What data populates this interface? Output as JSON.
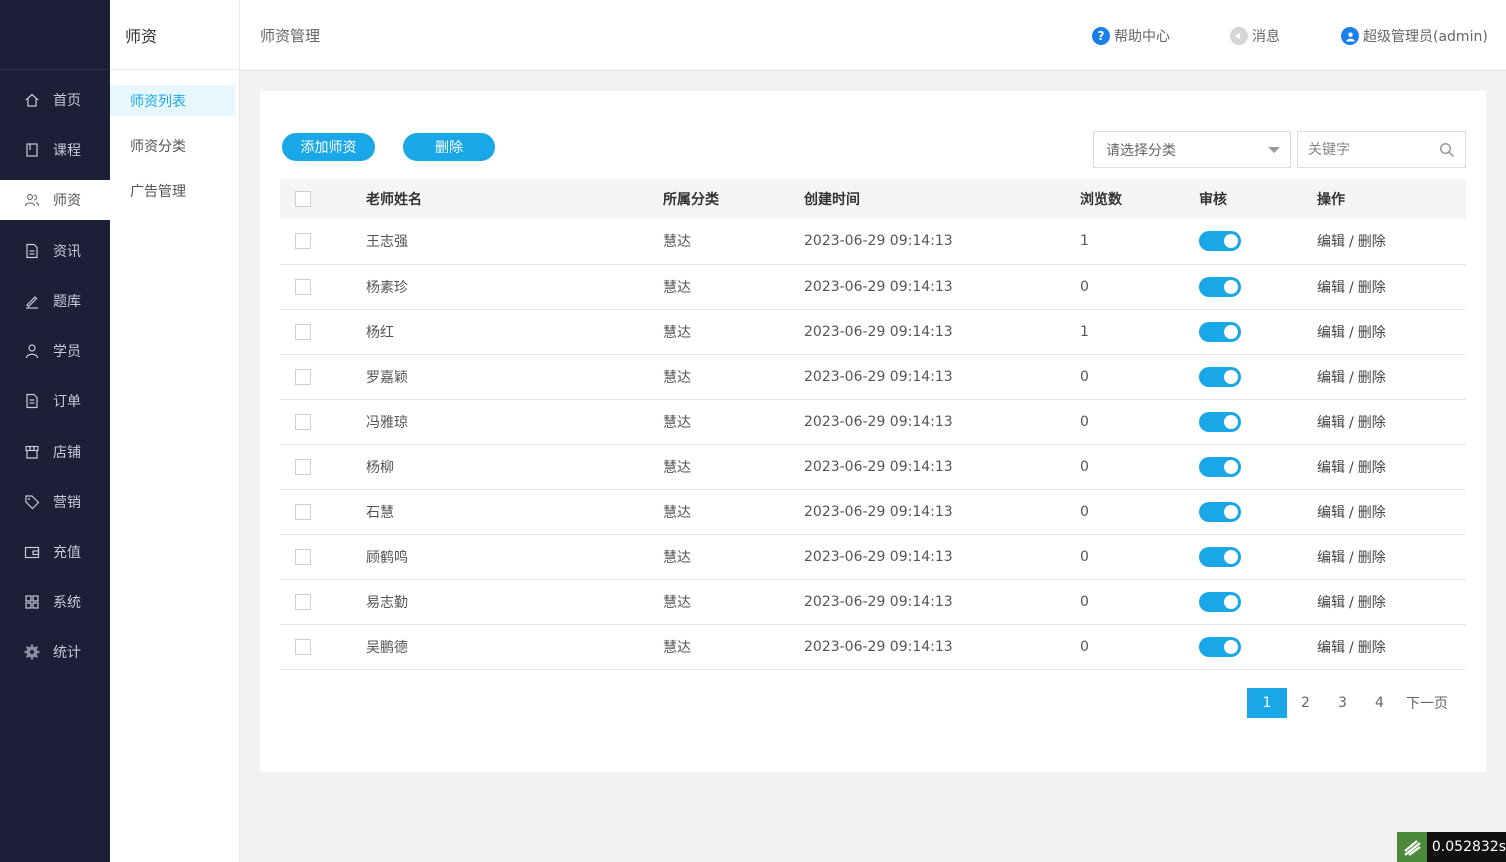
{
  "sidebar": {
    "items": [
      {
        "label": "首页",
        "icon": "home-icon"
      },
      {
        "label": "课程",
        "icon": "book-icon"
      },
      {
        "label": "师资",
        "icon": "users-icon"
      },
      {
        "label": "资讯",
        "icon": "news-icon"
      },
      {
        "label": "题库",
        "icon": "pen-icon"
      },
      {
        "label": "学员",
        "icon": "user-icon"
      },
      {
        "label": "订单",
        "icon": "order-icon"
      },
      {
        "label": "店铺",
        "icon": "shop-icon"
      },
      {
        "label": "营销",
        "icon": "tag-icon"
      },
      {
        "label": "充值",
        "icon": "wallet-icon"
      },
      {
        "label": "系统",
        "icon": "grid-icon"
      },
      {
        "label": "统计",
        "icon": "gear-icon"
      }
    ],
    "active": "师资"
  },
  "subnav": {
    "title": "师资",
    "items": [
      {
        "label": "师资列表"
      },
      {
        "label": "师资分类"
      },
      {
        "label": "广告管理"
      }
    ]
  },
  "header": {
    "title": "师资管理",
    "help": "帮助中心",
    "messages": "消息",
    "user": "超级管理员(admin)"
  },
  "toolbar": {
    "add_label": "添加师资",
    "delete_label": "删除",
    "category_placeholder": "请选择分类",
    "keyword_placeholder": "关键字"
  },
  "table": {
    "headers": {
      "name": "老师姓名",
      "category": "所属分类",
      "created": "创建时间",
      "views": "浏览数",
      "review": "审核",
      "ops": "操作"
    },
    "rows": [
      {
        "name": "王志强",
        "category": "慧达",
        "created": "2023-06-29 09:14:13",
        "views": "1",
        "review_on": true
      },
      {
        "name": "杨素珍",
        "category": "慧达",
        "created": "2023-06-29 09:14:13",
        "views": "0",
        "review_on": true
      },
      {
        "name": "杨红",
        "category": "慧达",
        "created": "2023-06-29 09:14:13",
        "views": "1",
        "review_on": true
      },
      {
        "name": "罗嘉颖",
        "category": "慧达",
        "created": "2023-06-29 09:14:13",
        "views": "0",
        "review_on": true
      },
      {
        "name": "冯雅琼",
        "category": "慧达",
        "created": "2023-06-29 09:14:13",
        "views": "0",
        "review_on": true
      },
      {
        "name": "杨柳",
        "category": "慧达",
        "created": "2023-06-29 09:14:13",
        "views": "0",
        "review_on": true
      },
      {
        "name": "石慧",
        "category": "慧达",
        "created": "2023-06-29 09:14:13",
        "views": "0",
        "review_on": true
      },
      {
        "name": "顾鹤鸣",
        "category": "慧达",
        "created": "2023-06-29 09:14:13",
        "views": "0",
        "review_on": true
      },
      {
        "name": "易志勤",
        "category": "慧达",
        "created": "2023-06-29 09:14:13",
        "views": "0",
        "review_on": true
      },
      {
        "name": "吴鹏德",
        "category": "慧达",
        "created": "2023-06-29 09:14:13",
        "views": "0",
        "review_on": true
      }
    ],
    "edit_label": "编辑",
    "op_separator": "/",
    "delete_label": "删除"
  },
  "pagination": {
    "pages": [
      "1",
      "2",
      "3",
      "4"
    ],
    "current": "1",
    "next_label": "下一页"
  },
  "timer": {
    "value": "0.052832s"
  },
  "colors": {
    "accent": "#1aa7e8",
    "sidebar_bg": "#1c1f36",
    "help_icon": "#1a7fe8"
  }
}
